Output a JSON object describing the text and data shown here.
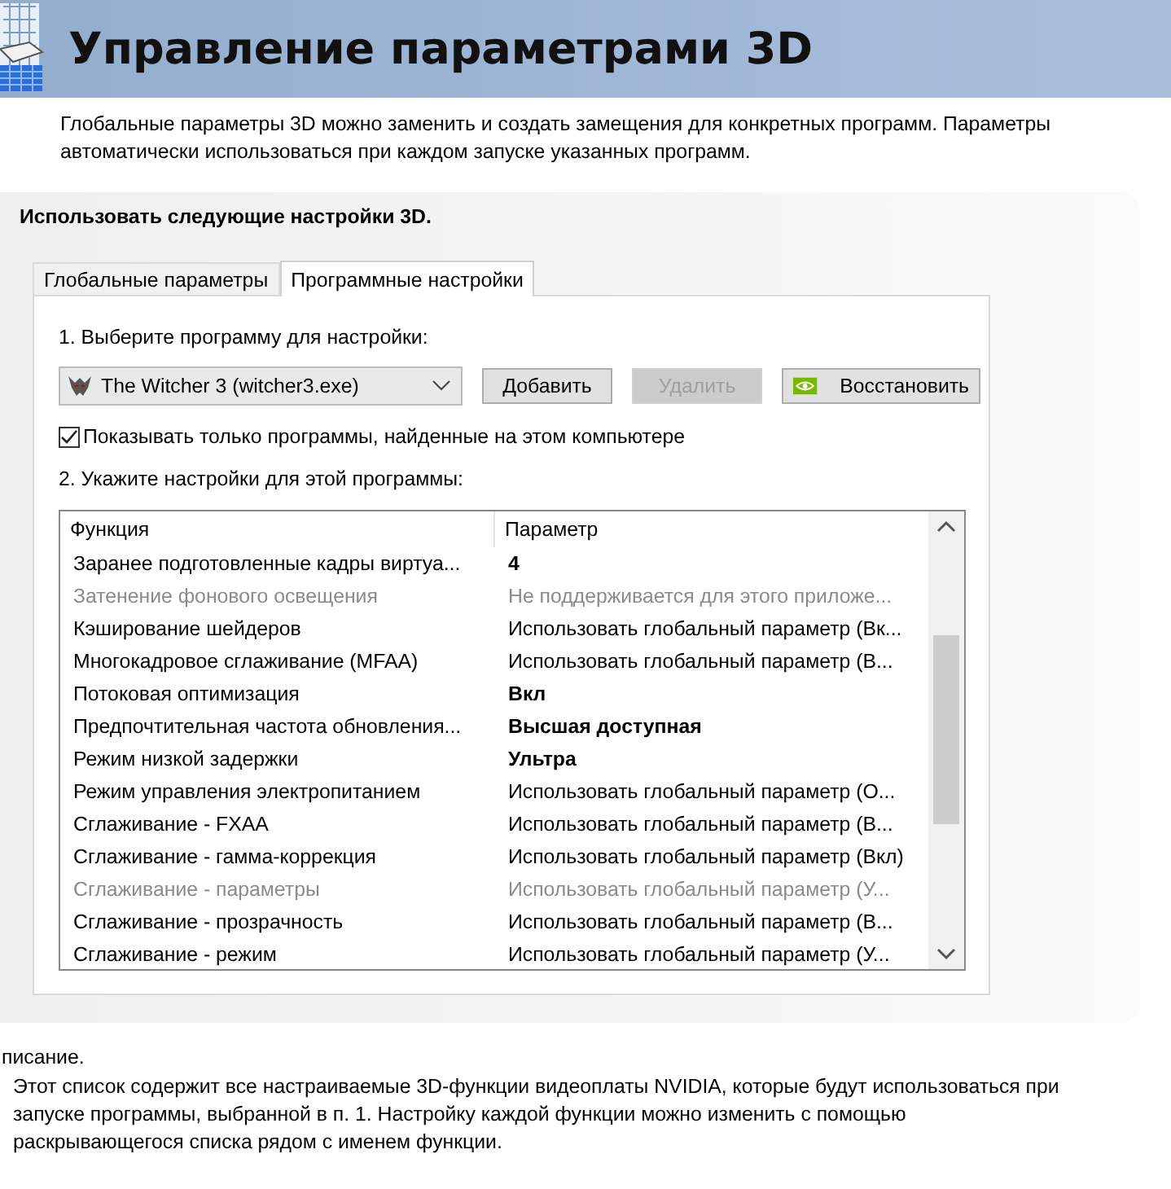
{
  "header": {
    "title": "Управление параметрами 3D"
  },
  "intro": [
    "Глобальные параметры 3D можно заменить и создать замещения для конкретных программ. Параметры",
    "автоматически использоваться при каждом запуске указанных программ."
  ],
  "panel": {
    "heading": "Использовать следующие настройки 3D.",
    "tabs": [
      {
        "label": "Глобальные параметры",
        "selected": false
      },
      {
        "label": "Программные настройки",
        "selected": true
      }
    ],
    "step1": "1. Выберите программу для настройки:",
    "program": {
      "value": "The Witcher 3 (witcher3.exe)"
    },
    "buttons": [
      {
        "label": "Добавить",
        "disabled": false,
        "kind": "plain"
      },
      {
        "label": "Удалить",
        "disabled": true,
        "kind": "plain"
      },
      {
        "label": "Восстановить",
        "disabled": false,
        "kind": "nvidia"
      }
    ],
    "filter": {
      "label": "Показывать только программы, найденные на этом компьютере",
      "checked": true
    },
    "step2": "2. Укажите настройки для этой программы:",
    "table": {
      "columns": [
        "Функция",
        "Параметр"
      ],
      "rows": [
        {
          "name": "Заранее подготовленные кадры виртуа...",
          "value": "4",
          "disabled": false,
          "bold": true
        },
        {
          "name": "Затенение фонового освещения",
          "value": "Не поддерживается для этого приложе...",
          "disabled": true,
          "bold": false
        },
        {
          "name": "Кэширование шейдеров",
          "value": "Использовать глобальный параметр (Вк...",
          "disabled": false,
          "bold": false
        },
        {
          "name": "Многокадровое сглаживание (MFAA)",
          "value": "Использовать глобальный параметр (В...",
          "disabled": false,
          "bold": false
        },
        {
          "name": "Потоковая оптимизация",
          "value": "Вкл",
          "disabled": false,
          "bold": true
        },
        {
          "name": "Предпочтительная частота обновления...",
          "value": "Высшая доступная",
          "disabled": false,
          "bold": true
        },
        {
          "name": "Режим низкой задержки",
          "value": "Ультра",
          "disabled": false,
          "bold": true
        },
        {
          "name": "Режим управления электропитанием",
          "value": "Использовать глобальный параметр (О...",
          "disabled": false,
          "bold": false
        },
        {
          "name": "Сглаживание - FXAA",
          "value": "Использовать глобальный параметр (В...",
          "disabled": false,
          "bold": false
        },
        {
          "name": "Сглаживание - гамма-коррекция",
          "value": "Использовать глобальный параметр (Вкл)",
          "disabled": false,
          "bold": false
        },
        {
          "name": "Сглаживание - параметры",
          "value": "Использовать глобальный параметр (У...",
          "disabled": true,
          "bold": false
        },
        {
          "name": "Сглаживание - прозрачность",
          "value": "Использовать глобальный параметр (В...",
          "disabled": false,
          "bold": false
        },
        {
          "name": "Сглаживание - режим",
          "value": "Использовать глобальный параметр (У...",
          "disabled": false,
          "bold": false
        }
      ]
    }
  },
  "description": {
    "heading": "писание.",
    "text": "Этот список содержит все настраиваемые 3D-функции видеоплаты NVIDIA, которые будут использоваться при запуске программы, выбранной в п. 1. Настройку каждой функции можно изменить с помощью раскрывающегося списка рядом с именем функции."
  }
}
